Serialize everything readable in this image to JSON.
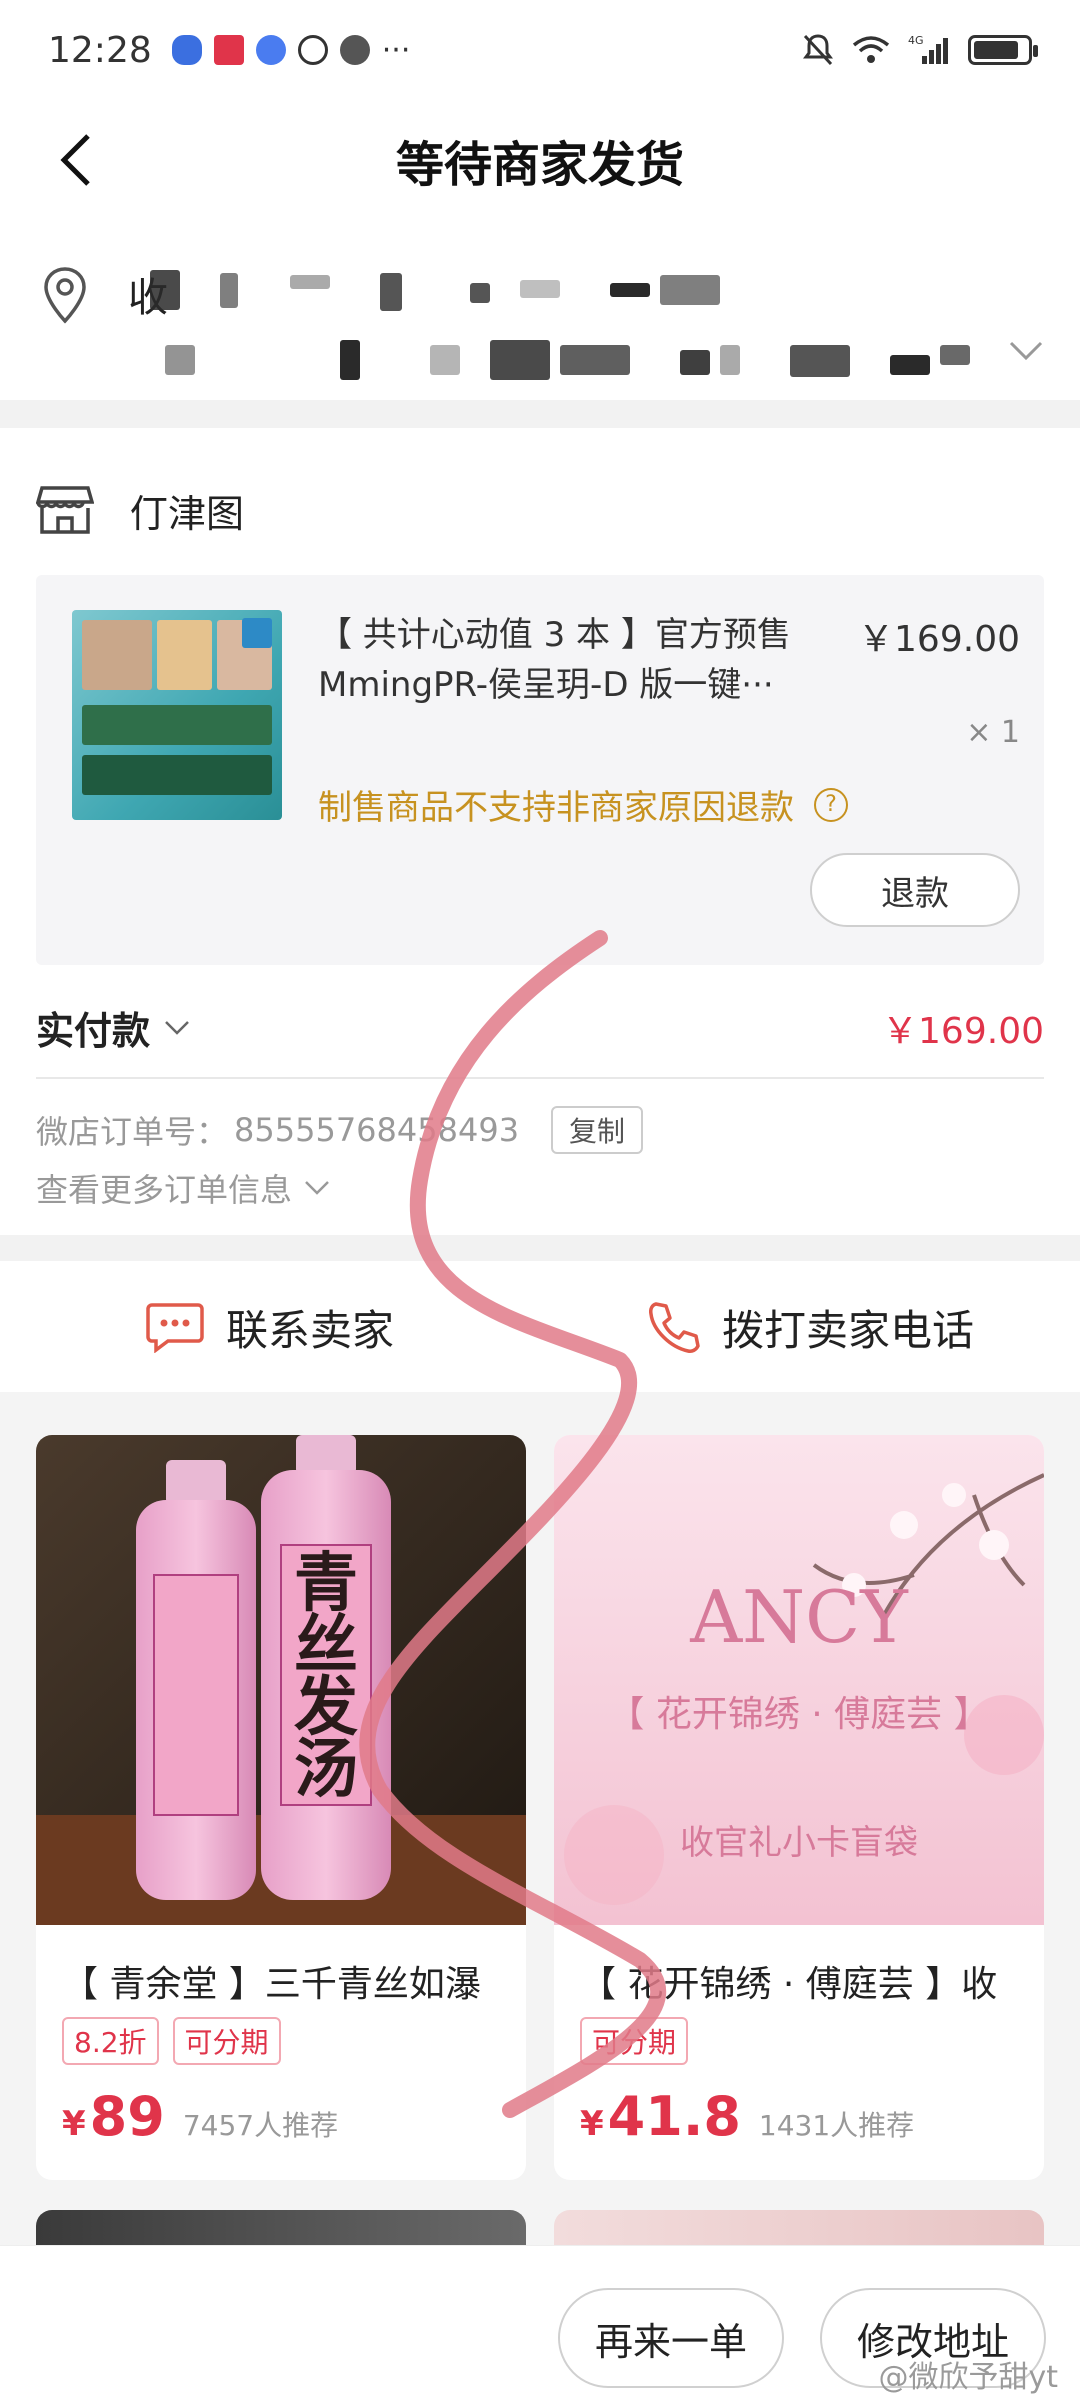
{
  "status_bar": {
    "time": "12:28",
    "more": "···"
  },
  "nav": {
    "title": "等待商家发货"
  },
  "address": {
    "line1_visible": "收"
  },
  "store": {
    "name": "仃津图"
  },
  "product": {
    "title": "【 共计心动值 3 本 】官方预售 MmingPR-侯呈玥-D 版一键···",
    "price": "￥169.00",
    "quantity": "× 1",
    "notice": "制售商品不支持非商家原因退款",
    "help_icon": "?",
    "refund_label": "退款"
  },
  "payment": {
    "label": "实付款",
    "amount": "￥169.00"
  },
  "order": {
    "number_label": "微店订单号：",
    "number_value": "85555768458493",
    "copy_label": "复制",
    "more_label": "查看更多订单信息"
  },
  "contact": {
    "seller_label": "联系卖家",
    "call_label": "拨打卖家电话"
  },
  "recommendations": [
    {
      "title": "【 青余堂 】三千青丝如瀑",
      "tags": [
        "8.2折",
        "可分期"
      ],
      "yen": "¥",
      "price": "89",
      "recommend_count": "7457人推荐",
      "image_text": {
        "bottle_text": "青丝发汤"
      }
    },
    {
      "title": "【 花开锦绣 · 傅庭芸 】收",
      "tags": [
        "可分期"
      ],
      "yen": "¥",
      "price": "41.8",
      "recommend_count": "1431人推荐",
      "image_text": {
        "brand": "ANCY",
        "subtitle": "【 花开锦绣 · 傅庭芸 】",
        "caption": "收官礼小卡盲袋"
      }
    }
  ],
  "bottom_bar": {
    "reorder_label": "再来一单",
    "change_address_label": "修改地址"
  },
  "watermark": "@微欣予甜yt",
  "colors": {
    "accent_red": "#e0344a",
    "warning_gold": "#c79220",
    "scribble_pink": "#e07a88"
  }
}
